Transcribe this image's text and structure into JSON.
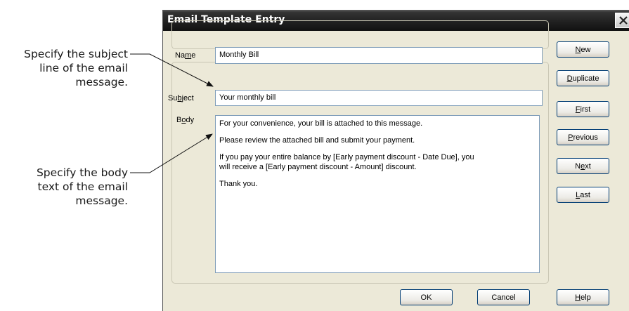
{
  "callouts": {
    "subject": [
      "Specify the subject",
      "line of the email",
      "message."
    ],
    "body": [
      "Specify the body",
      "text of the email",
      "message."
    ]
  },
  "dialog": {
    "title": "Email Template Entry",
    "close_icon": "close-icon"
  },
  "fields": {
    "name": {
      "label_pre": "Na",
      "label_key": "m",
      "label_post": "e",
      "value": "Monthly Bill"
    },
    "subject": {
      "label_pre": "Su",
      "label_key": "b",
      "label_post": "ject",
      "value": "Your monthly bill"
    },
    "body": {
      "label_pre": "B",
      "label_key": "o",
      "label_post": "dy",
      "paragraphs": [
        "For your convenience, your bill is attached to this message.",
        "Please review the attached bill and submit your payment.",
        "If you pay your entire balance by [Early payment discount - Date Due], you\nwill receive a [Early payment discount - Amount] discount.",
        "Thank you."
      ]
    }
  },
  "buttons": {
    "new": {
      "pre": "",
      "key": "N",
      "post": "ew"
    },
    "duplicate": {
      "pre": "",
      "key": "D",
      "post": "uplicate"
    },
    "first": {
      "pre": "",
      "key": "F",
      "post": "irst"
    },
    "previous": {
      "pre": "",
      "key": "P",
      "post": "revious"
    },
    "next": {
      "pre": "N",
      "key": "e",
      "post": "xt"
    },
    "last": {
      "pre": "",
      "key": "L",
      "post": "ast"
    },
    "ok": "OK",
    "cancel": "Cancel",
    "help": {
      "pre": "",
      "key": "H",
      "post": "elp"
    }
  }
}
